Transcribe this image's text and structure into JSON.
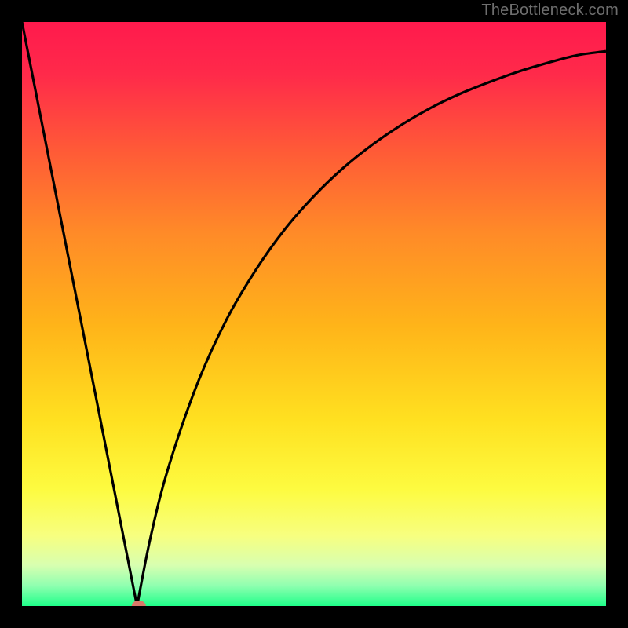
{
  "watermark": "TheBottleneck.com",
  "chart_data": {
    "type": "line",
    "title": "",
    "xlabel": "",
    "ylabel": "",
    "xlim": [
      0,
      1
    ],
    "ylim": [
      0,
      1
    ],
    "series": [
      {
        "name": "curve",
        "x": [
          0.0,
          0.05,
          0.1,
          0.15,
          0.197,
          0.22,
          0.25,
          0.3,
          0.35,
          0.4,
          0.45,
          0.5,
          0.55,
          0.6,
          0.65,
          0.7,
          0.75,
          0.8,
          0.85,
          0.9,
          0.95,
          1.0
        ],
        "y": [
          1.0,
          0.746,
          0.493,
          0.239,
          0.0,
          0.117,
          0.235,
          0.38,
          0.49,
          0.575,
          0.645,
          0.702,
          0.75,
          0.79,
          0.824,
          0.853,
          0.877,
          0.897,
          0.915,
          0.93,
          0.943,
          0.95
        ]
      }
    ],
    "marker": {
      "x": 0.2,
      "y": 0.0
    },
    "background_gradient": {
      "stops": [
        {
          "offset": 0.0,
          "color": "#ff1a4d"
        },
        {
          "offset": 0.09,
          "color": "#ff2a4a"
        },
        {
          "offset": 0.22,
          "color": "#ff5a37"
        },
        {
          "offset": 0.36,
          "color": "#ff8a28"
        },
        {
          "offset": 0.52,
          "color": "#ffb419"
        },
        {
          "offset": 0.68,
          "color": "#ffe020"
        },
        {
          "offset": 0.8,
          "color": "#fdfb40"
        },
        {
          "offset": 0.88,
          "color": "#f7ff80"
        },
        {
          "offset": 0.93,
          "color": "#d8ffb0"
        },
        {
          "offset": 0.965,
          "color": "#90ffb0"
        },
        {
          "offset": 1.0,
          "color": "#20ff8a"
        }
      ]
    }
  }
}
